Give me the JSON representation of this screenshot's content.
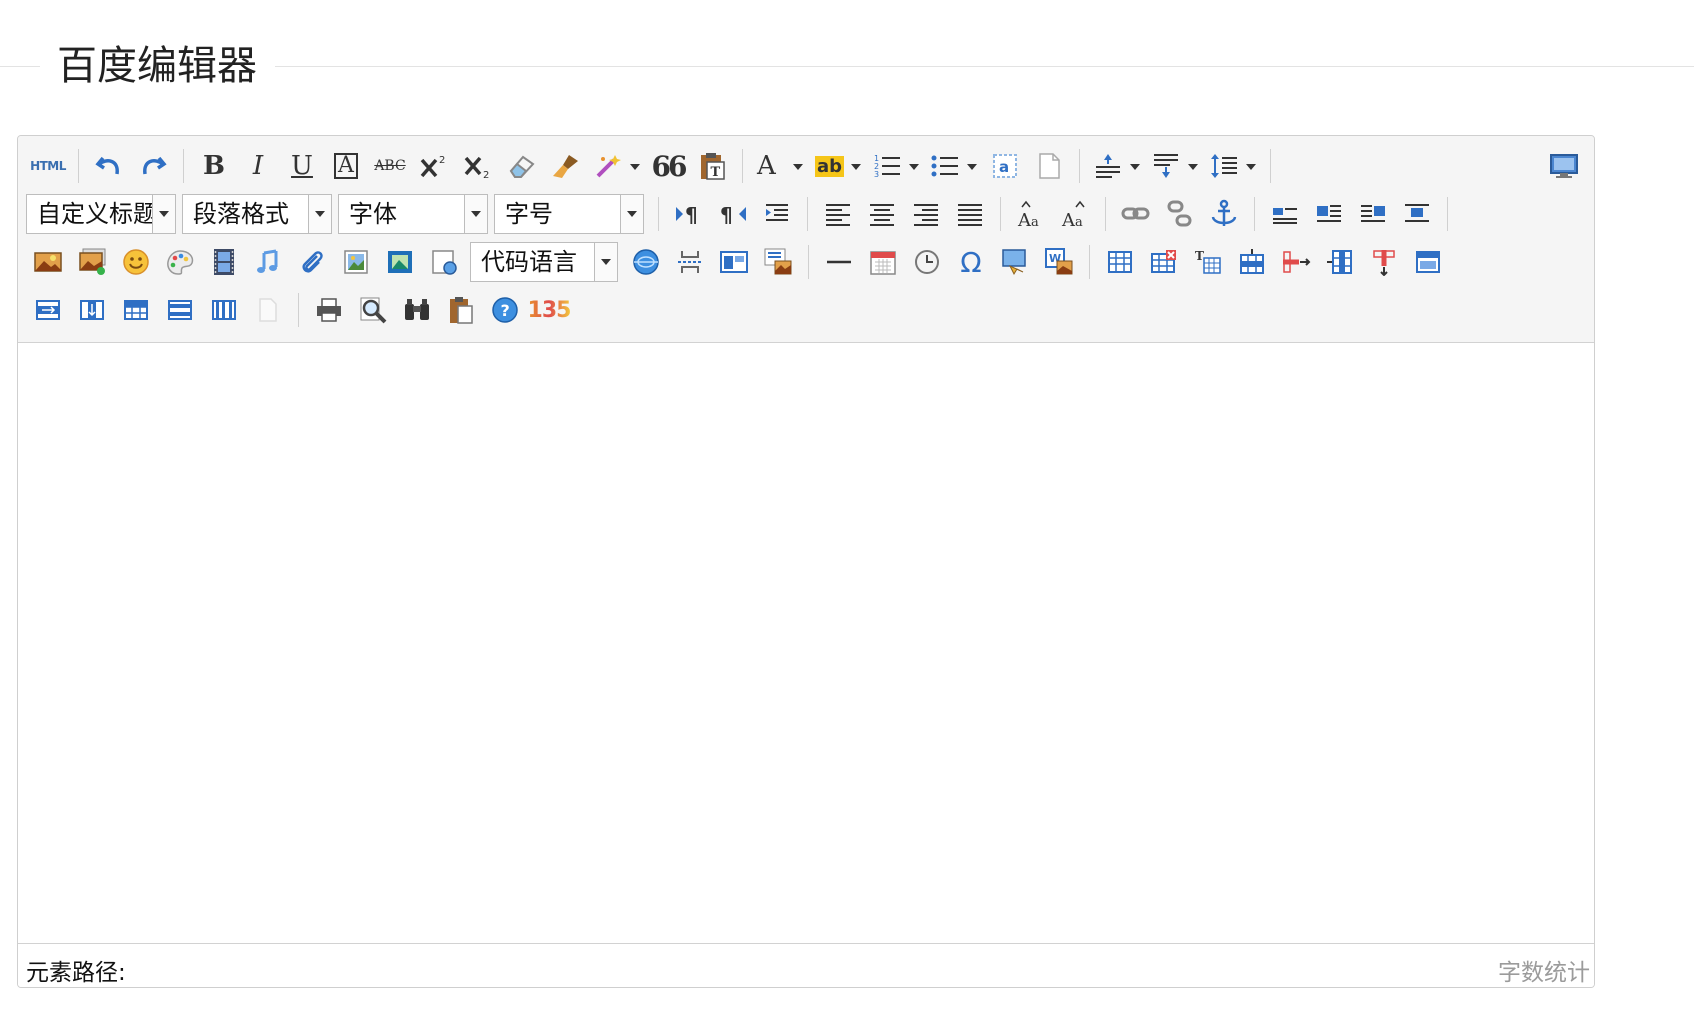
{
  "page": {
    "title": "百度编辑器"
  },
  "toolbar": {
    "html_label": "HTML",
    "custom_heading": "自定义标题",
    "paragraph_format": "段落格式",
    "font_family": "字体",
    "font_size": "字号",
    "code_language": "代码语言",
    "bold_glyph": "B",
    "italic_glyph": "I",
    "underline_glyph": "U",
    "fontborder_glyph": "A",
    "strike_glyph": "ABC",
    "quote_glyph": "66",
    "forecolor_glyph": "A",
    "backcolor_glyph": "ab",
    "omega_glyph": "Ω",
    "service_glyph": "135"
  },
  "statusbar": {
    "element_path": "元素路径:",
    "word_count": "字数统计"
  },
  "colors": {
    "toolbar_bg": "#f5f5f5",
    "border": "#cfcfcf",
    "icon_blue": "#2f6fc4",
    "accent_orange": "#e8922f"
  }
}
